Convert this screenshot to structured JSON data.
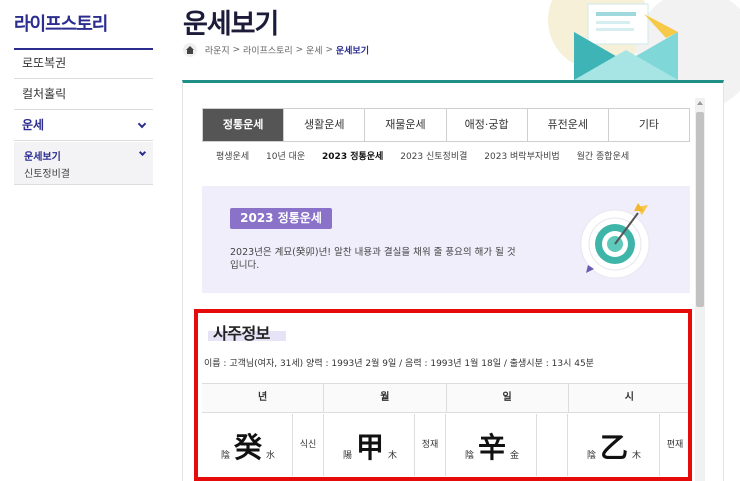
{
  "sidebar": {
    "title": "라이프스토리",
    "items": [
      {
        "label": "로또복권"
      },
      {
        "label": "컬처홀릭"
      },
      {
        "label": "운세"
      }
    ],
    "sub_items": [
      {
        "label": "운세보기"
      },
      {
        "label": "신토정비결"
      }
    ]
  },
  "header": {
    "title": "운세보기",
    "breadcrumb": [
      "라운지",
      "라이프스토리",
      "운세",
      "운세보기"
    ],
    "breadcrumb_sep": ">"
  },
  "tabs": [
    {
      "label": "정통운세"
    },
    {
      "label": "생활운세"
    },
    {
      "label": "재물운세"
    },
    {
      "label": "애정·궁합"
    },
    {
      "label": "퓨전운세"
    },
    {
      "label": "기타"
    }
  ],
  "subtabs": [
    {
      "label": "평생운세"
    },
    {
      "label": "10년 대운"
    },
    {
      "label": "2023 정통운세"
    },
    {
      "label": "2023 신토정비결"
    },
    {
      "label": "2023 벼락부자비법"
    },
    {
      "label": "월간 종합운세"
    }
  ],
  "banner": {
    "tag": "2023 정통운세",
    "text": "2023년은 계묘(癸卯)년! 알찬 내용과 결실을 채워 줄 풍요의 해가 될 것입니다."
  },
  "saju": {
    "title": "사주정보",
    "info": "이름 : 고객님(여자, 31세)   양력 : 1993년 2월 9일 / 음력 : 1993년 1월 18일 / 출생시분 : 13시 45분",
    "columns": [
      "년",
      "월",
      "일",
      "시"
    ],
    "pillars": [
      {
        "yin": "陰",
        "char": "癸",
        "elem": "水",
        "role": "식신"
      },
      {
        "yin": "陽",
        "char": "甲",
        "elem": "木",
        "role": "정재"
      },
      {
        "yin": "陰",
        "char": "辛",
        "elem": "金",
        "role": ""
      },
      {
        "yin": "陰",
        "char": "乙",
        "elem": "木",
        "role": "편재"
      }
    ]
  },
  "colors": {
    "brand": "#2b2d8f",
    "accent_teal": "#1e8e86",
    "tab_active": "#555555",
    "banner_bg": "#efeefa",
    "banner_tag": "#8a72c9",
    "highlight_box": "#e50b0b"
  },
  "icons": {
    "home": "home-icon",
    "chevron": "chevron-down-icon",
    "envelope": "envelope-illustration-icon",
    "target": "target-arrow-icon"
  }
}
